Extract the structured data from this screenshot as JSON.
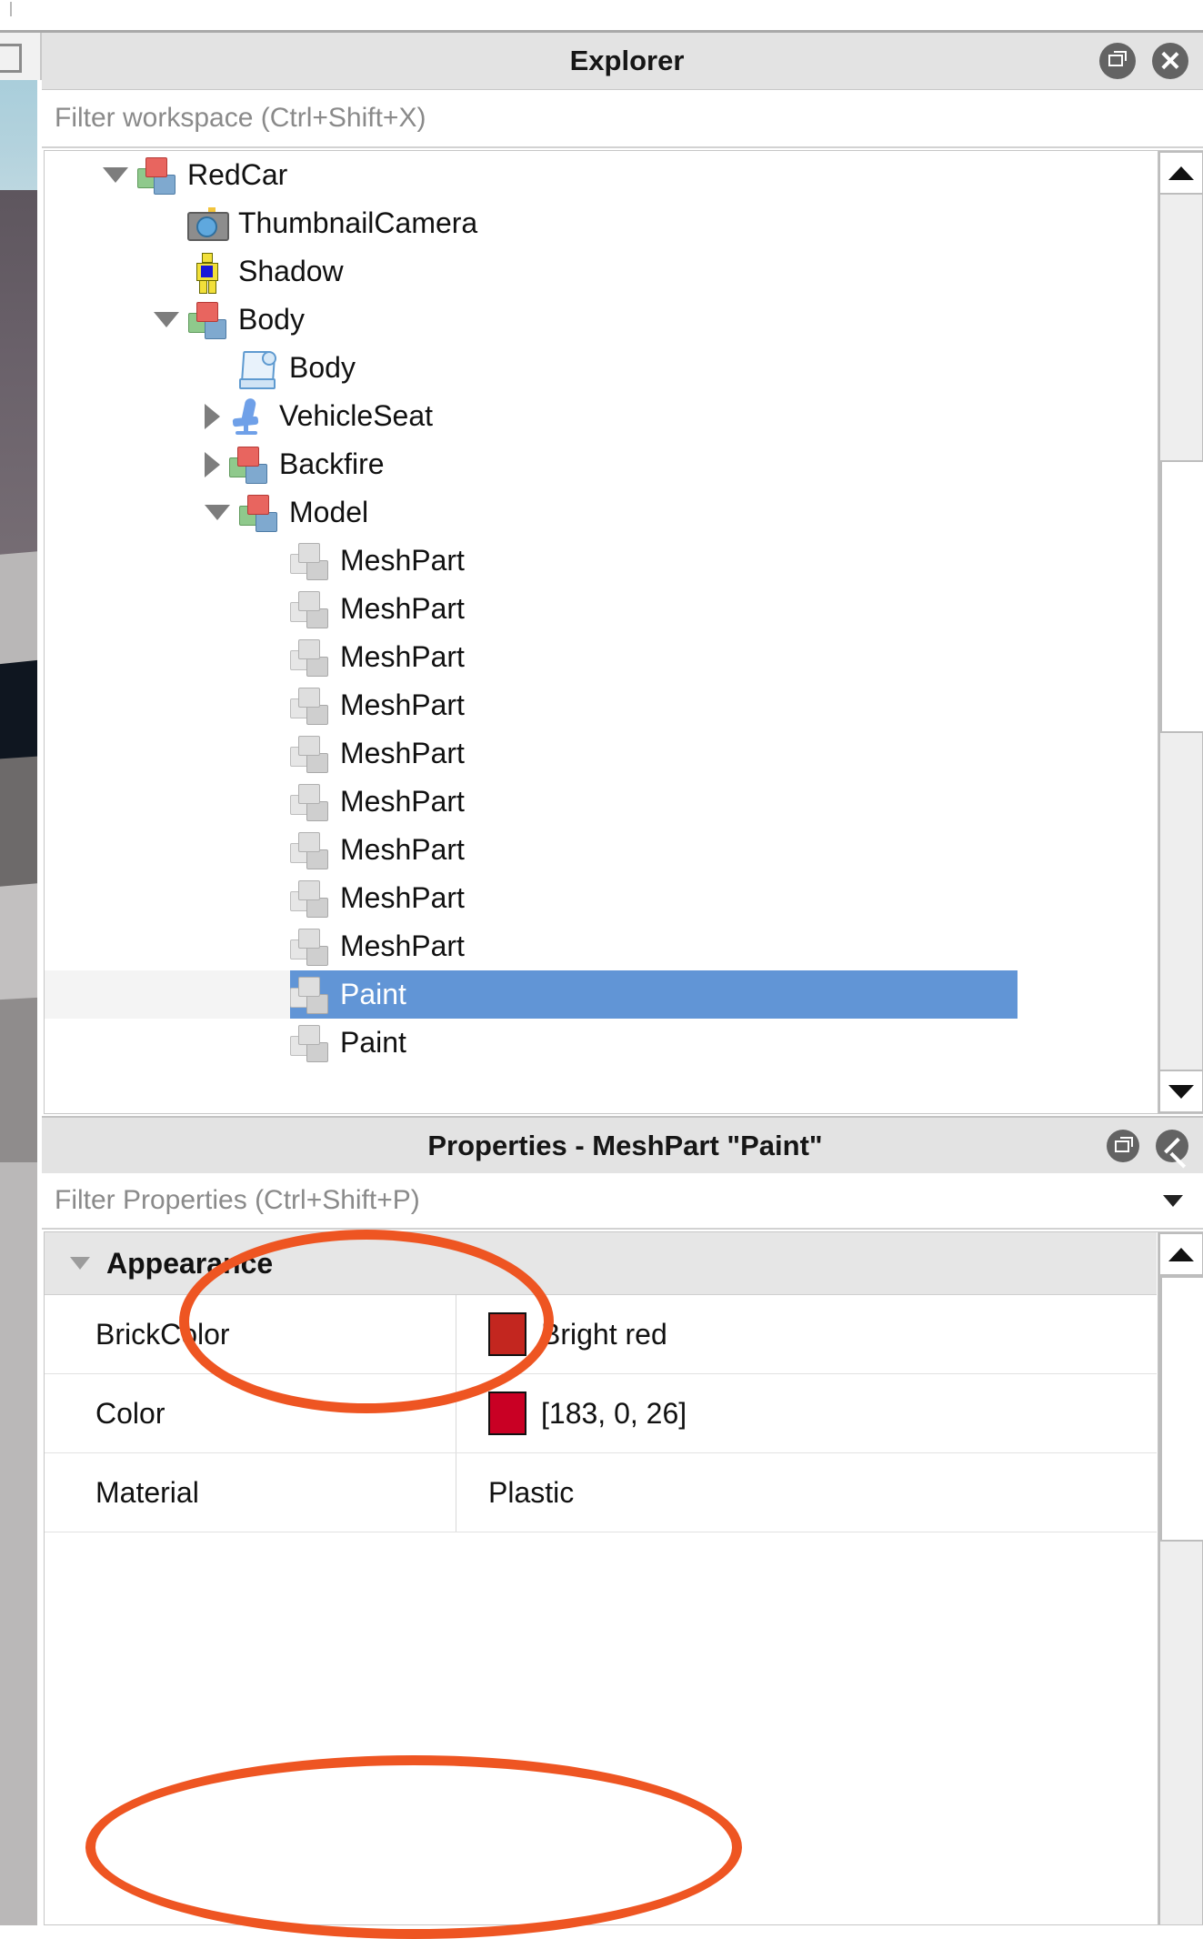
{
  "explorer": {
    "title": "Explorer",
    "filter_placeholder": "Filter workspace (Ctrl+Shift+X)",
    "restore_icon": "restore-window-icon",
    "close_icon": "close-icon",
    "tree": [
      {
        "label": "RedCar",
        "icon": "model-icon",
        "twisty": "down",
        "indent": 0,
        "selected": false
      },
      {
        "label": "ThumbnailCamera",
        "icon": "camera-icon",
        "twisty": "none",
        "indent": 1,
        "selected": false
      },
      {
        "label": "Shadow",
        "icon": "humanoid-icon",
        "twisty": "none",
        "indent": 1,
        "selected": false
      },
      {
        "label": "Body",
        "icon": "model-icon",
        "twisty": "down",
        "indent": 1,
        "selected": false
      },
      {
        "label": "Body",
        "icon": "script-icon",
        "twisty": "none",
        "indent": 2,
        "selected": false
      },
      {
        "label": "VehicleSeat",
        "icon": "seat-icon",
        "twisty": "right",
        "indent": 2,
        "selected": false
      },
      {
        "label": "Backfire",
        "icon": "model-icon",
        "twisty": "right",
        "indent": 2,
        "selected": false
      },
      {
        "label": "Model",
        "icon": "model-icon",
        "twisty": "down",
        "indent": 2,
        "selected": false
      },
      {
        "label": "MeshPart",
        "icon": "meshpart-icon",
        "twisty": "none",
        "indent": 3,
        "selected": false
      },
      {
        "label": "MeshPart",
        "icon": "meshpart-icon",
        "twisty": "none",
        "indent": 3,
        "selected": false
      },
      {
        "label": "MeshPart",
        "icon": "meshpart-icon",
        "twisty": "none",
        "indent": 3,
        "selected": false
      },
      {
        "label": "MeshPart",
        "icon": "meshpart-icon",
        "twisty": "none",
        "indent": 3,
        "selected": false
      },
      {
        "label": "MeshPart",
        "icon": "meshpart-icon",
        "twisty": "none",
        "indent": 3,
        "selected": false
      },
      {
        "label": "MeshPart",
        "icon": "meshpart-icon",
        "twisty": "none",
        "indent": 3,
        "selected": false
      },
      {
        "label": "MeshPart",
        "icon": "meshpart-icon",
        "twisty": "none",
        "indent": 3,
        "selected": false
      },
      {
        "label": "MeshPart",
        "icon": "meshpart-icon",
        "twisty": "none",
        "indent": 3,
        "selected": false
      },
      {
        "label": "MeshPart",
        "icon": "meshpart-icon",
        "twisty": "none",
        "indent": 3,
        "selected": false
      },
      {
        "label": "Paint",
        "icon": "meshpart-icon",
        "twisty": "none",
        "indent": 3,
        "selected": true
      },
      {
        "label": "Paint",
        "icon": "meshpart-icon",
        "twisty": "none",
        "indent": 3,
        "selected": false
      }
    ],
    "selection_color": "#6195d6",
    "scrollbar": {
      "up_icon": "scroll-up-arrow-icon",
      "down_icon": "scroll-down-arrow-icon"
    }
  },
  "properties": {
    "title": "Properties - MeshPart \"Paint\"",
    "filter_placeholder": "Filter Properties (Ctrl+Shift+P)",
    "filter_dropdown_icon": "funnel-icon",
    "restore_icon": "restore-window-icon",
    "close_icon": "close-icon",
    "groups": [
      {
        "name": "Appearance",
        "collapsed": false,
        "rows": [
          {
            "name": "BrickColor",
            "value": "Bright red",
            "swatch": "#c3261f"
          },
          {
            "name": "Color",
            "value": "[183, 0, 26]",
            "swatch": "#c90024"
          },
          {
            "name": "Material",
            "value": "Plastic",
            "swatch": null
          }
        ]
      }
    ],
    "scrollbar": {
      "up_icon": "scroll-up-arrow-icon"
    }
  },
  "annotations": {
    "accent_color": "#ee5522",
    "marks": [
      {
        "target": "paint-tree-item",
        "shape": "ellipse"
      },
      {
        "target": "color-property-row",
        "shape": "ellipse"
      }
    ]
  }
}
